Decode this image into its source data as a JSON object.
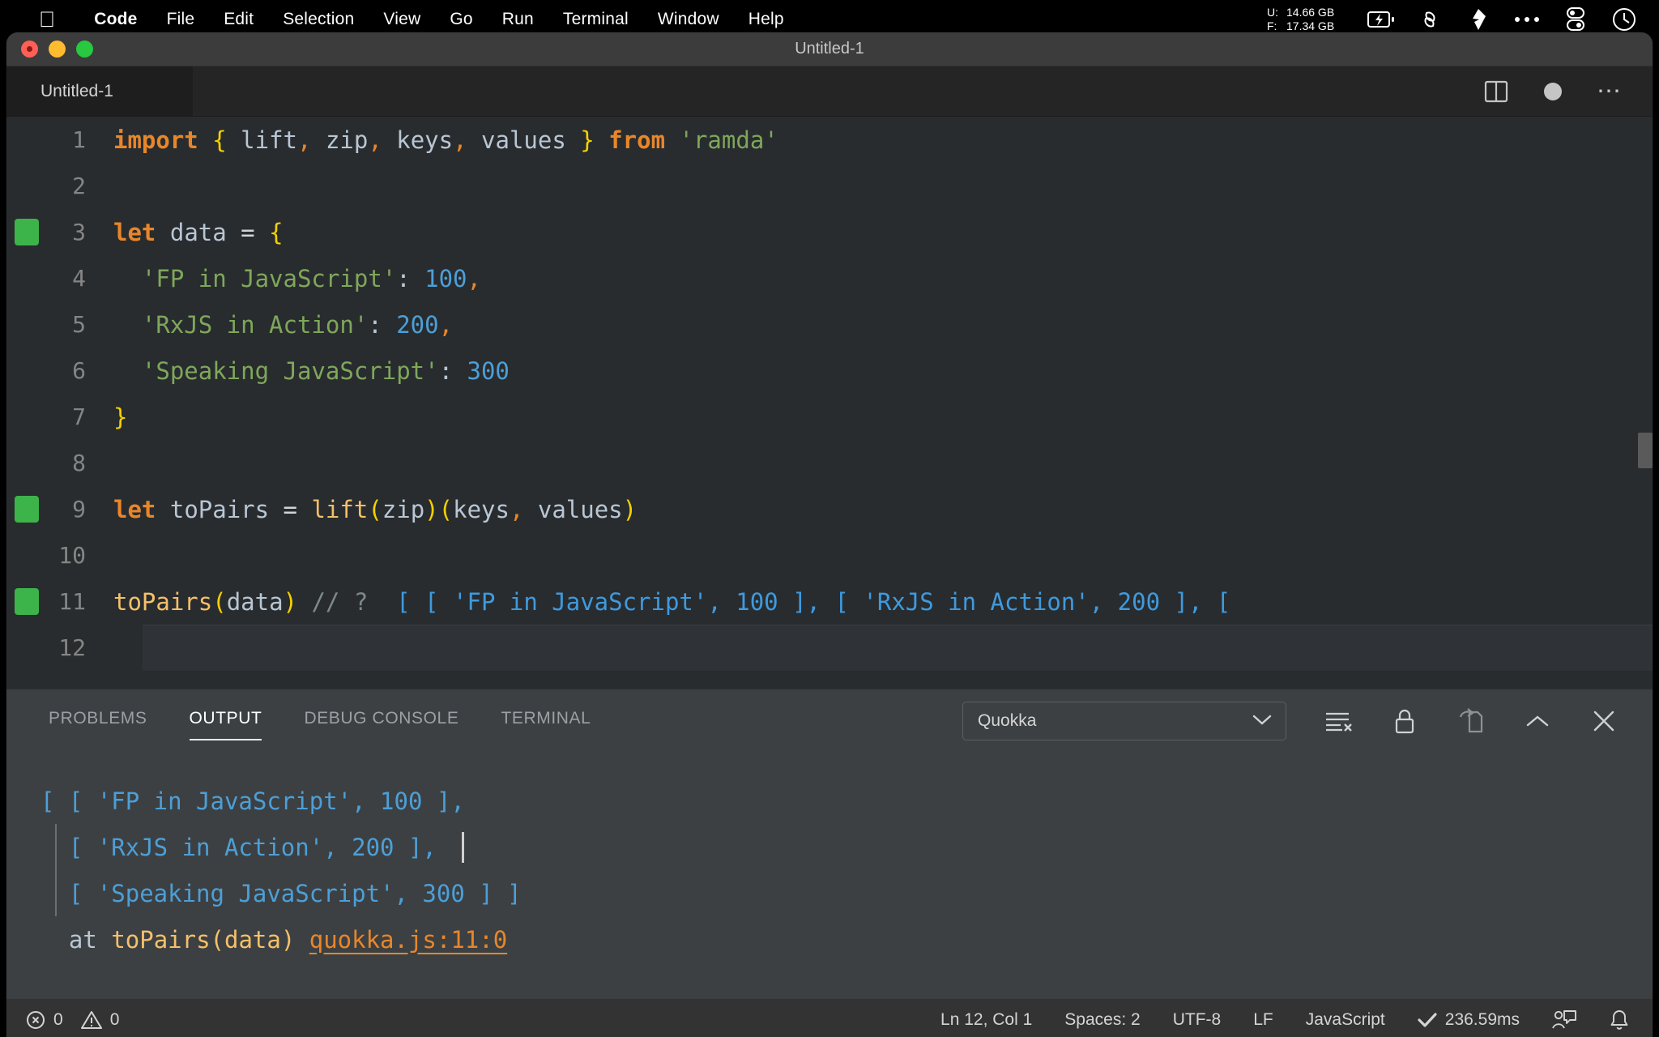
{
  "menubar": {
    "apple_icon": "apple-logo-icon",
    "items": [
      {
        "label": "Code",
        "bold": true
      },
      {
        "label": "File",
        "bold": false
      },
      {
        "label": "Edit",
        "bold": false
      },
      {
        "label": "Selection",
        "bold": false
      },
      {
        "label": "View",
        "bold": false
      },
      {
        "label": "Go",
        "bold": false
      },
      {
        "label": "Run",
        "bold": false
      },
      {
        "label": "Terminal",
        "bold": false
      },
      {
        "label": "Window",
        "bold": false
      },
      {
        "label": "Help",
        "bold": false
      }
    ],
    "memory": {
      "used_label": "U:",
      "used_value": "14.66 GB",
      "free_label": "F:",
      "free_value": "17.34 GB"
    },
    "tray_icons": [
      "battery-charging-icon",
      "link-chain-icon",
      "shape-icon",
      "ellipsis-icon",
      "toggle-switch-icon",
      "clock-icon"
    ]
  },
  "window": {
    "title": "Untitled-1",
    "traffic_lights": [
      "close-button",
      "minimize-button",
      "maximize-button"
    ]
  },
  "tabbar": {
    "tab_label": "Untitled-1",
    "actions": [
      "split-editor-icon",
      "unsaved-dot-icon",
      "more-actions-icon"
    ]
  },
  "editor": {
    "language": "JavaScript",
    "lines": [
      {
        "n": "1",
        "mark": false,
        "tokens": [
          {
            "t": "import",
            "c": "kw"
          },
          {
            "t": " ",
            "c": "op"
          },
          {
            "t": "{",
            "c": "brace"
          },
          {
            "t": " lift",
            "c": "ident"
          },
          {
            "t": ",",
            "c": "punc"
          },
          {
            "t": " zip",
            "c": "ident"
          },
          {
            "t": ",",
            "c": "punc"
          },
          {
            "t": " keys",
            "c": "ident"
          },
          {
            "t": ",",
            "c": "punc"
          },
          {
            "t": " values",
            "c": "ident"
          },
          {
            "t": " ",
            "c": "op"
          },
          {
            "t": "}",
            "c": "brace"
          },
          {
            "t": " ",
            "c": "op"
          },
          {
            "t": "from",
            "c": "kw"
          },
          {
            "t": " ",
            "c": "op"
          },
          {
            "t": "'ramda'",
            "c": "str"
          }
        ]
      },
      {
        "n": "2",
        "mark": false,
        "tokens": []
      },
      {
        "n": "3",
        "mark": true,
        "tokens": [
          {
            "t": "let",
            "c": "kw"
          },
          {
            "t": " ",
            "c": "op"
          },
          {
            "t": "data",
            "c": "ident"
          },
          {
            "t": " = ",
            "c": "op"
          },
          {
            "t": "{",
            "c": "brace"
          }
        ]
      },
      {
        "n": "4",
        "mark": false,
        "tokens": [
          {
            "t": "  ",
            "c": "op"
          },
          {
            "t": "'FP in JavaScript'",
            "c": "str"
          },
          {
            "t": ":",
            "c": "colon"
          },
          {
            "t": " ",
            "c": "op"
          },
          {
            "t": "100",
            "c": "num"
          },
          {
            "t": ",",
            "c": "punc"
          }
        ]
      },
      {
        "n": "5",
        "mark": false,
        "tokens": [
          {
            "t": "  ",
            "c": "op"
          },
          {
            "t": "'RxJS in Action'",
            "c": "str"
          },
          {
            "t": ":",
            "c": "colon"
          },
          {
            "t": " ",
            "c": "op"
          },
          {
            "t": "200",
            "c": "num"
          },
          {
            "t": ",",
            "c": "punc"
          }
        ]
      },
      {
        "n": "6",
        "mark": false,
        "tokens": [
          {
            "t": "  ",
            "c": "op"
          },
          {
            "t": "'Speaking JavaScript'",
            "c": "str"
          },
          {
            "t": ":",
            "c": "colon"
          },
          {
            "t": " ",
            "c": "op"
          },
          {
            "t": "300",
            "c": "num"
          }
        ]
      },
      {
        "n": "7",
        "mark": false,
        "tokens": [
          {
            "t": "}",
            "c": "brace"
          }
        ]
      },
      {
        "n": "8",
        "mark": false,
        "tokens": []
      },
      {
        "n": "9",
        "mark": true,
        "tokens": [
          {
            "t": "let",
            "c": "kw"
          },
          {
            "t": " ",
            "c": "op"
          },
          {
            "t": "toPairs",
            "c": "ident"
          },
          {
            "t": " = ",
            "c": "op"
          },
          {
            "t": "lift",
            "c": "fn"
          },
          {
            "t": "(",
            "c": "paren"
          },
          {
            "t": "zip",
            "c": "ident"
          },
          {
            "t": ")",
            "c": "paren"
          },
          {
            "t": "(",
            "c": "paren"
          },
          {
            "t": "keys",
            "c": "ident"
          },
          {
            "t": ",",
            "c": "punc"
          },
          {
            "t": " values",
            "c": "ident"
          },
          {
            "t": ")",
            "c": "paren"
          }
        ]
      },
      {
        "n": "10",
        "mark": false,
        "tokens": []
      },
      {
        "n": "11",
        "mark": true,
        "tokens": [
          {
            "t": "toPairs",
            "c": "fn"
          },
          {
            "t": "(",
            "c": "paren"
          },
          {
            "t": "data",
            "c": "ident"
          },
          {
            "t": ")",
            "c": "paren"
          },
          {
            "t": " ",
            "c": "op"
          },
          {
            "t": "// ?",
            "c": "comment"
          },
          {
            "t": "  [ [ 'FP in JavaScript', 100 ], [ 'RxJS in Action', 200 ], [",
            "c": "quokka"
          }
        ]
      },
      {
        "n": "12",
        "mark": false,
        "tokens": []
      }
    ]
  },
  "panel": {
    "tabs": [
      {
        "label": "PROBLEMS",
        "active": false
      },
      {
        "label": "OUTPUT",
        "active": true
      },
      {
        "label": "DEBUG CONSOLE",
        "active": false
      },
      {
        "label": "TERMINAL",
        "active": false
      }
    ],
    "channel_select": {
      "value": "Quokka",
      "chevron": "chevron-down-icon"
    },
    "actions": [
      "clear-output-icon",
      "lock-scroll-icon",
      "open-in-editor-icon",
      "maximize-panel-icon",
      "close-panel-icon"
    ],
    "output_lines": [
      {
        "segments": [
          {
            "t": "[ [ 'FP in JavaScript', 100 ],",
            "c": "out-blue"
          }
        ],
        "indent": 0,
        "caret": false
      },
      {
        "segments": [
          {
            "t": "  [ 'RxJS in Action', 200 ], ",
            "c": "out-blue"
          }
        ],
        "indent": 0,
        "caret": true
      },
      {
        "segments": [
          {
            "t": "  [ 'Speaking JavaScript', 300 ] ]",
            "c": "out-blue"
          }
        ],
        "indent": 0,
        "caret": false
      },
      {
        "segments": [
          {
            "t": "  at ",
            "c": "out-at"
          },
          {
            "t": "toPairs(data) ",
            "c": "out-fn"
          },
          {
            "t": "quokka.js:11:0",
            "c": "out-link"
          }
        ],
        "indent": 0,
        "caret": false
      }
    ]
  },
  "statusbar": {
    "errors_icon": "error-circle-icon",
    "errors_count": "0",
    "warnings_icon": "warning-triangle-icon",
    "warnings_count": "0",
    "cursor_position": "Ln 12, Col 1",
    "indentation": "Spaces: 2",
    "encoding": "UTF-8",
    "eol": "LF",
    "language_mode": "JavaScript",
    "quokka_status_icon": "check-icon",
    "quokka_time": "236.59ms",
    "feedback_icon": "feedback-person-icon",
    "notifications_icon": "bell-icon"
  }
}
